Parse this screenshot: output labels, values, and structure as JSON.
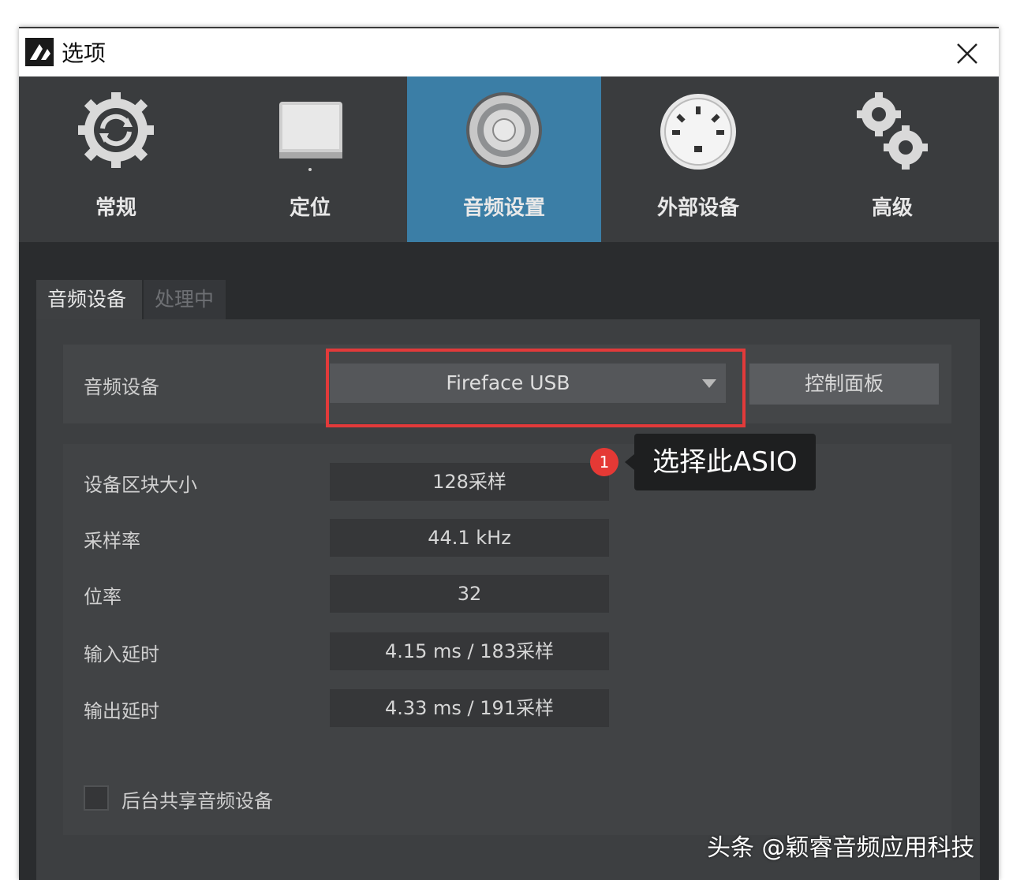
{
  "window": {
    "title": "选项",
    "close_icon": "close-icon"
  },
  "toolbar": {
    "items": [
      {
        "label": "常规",
        "icon": "gear-sync-icon",
        "active": false
      },
      {
        "label": "定位",
        "icon": "drive-icon",
        "active": false
      },
      {
        "label": "音频设置",
        "icon": "speaker-icon",
        "active": true
      },
      {
        "label": "外部设备",
        "icon": "midi-port-icon",
        "active": false
      },
      {
        "label": "高级",
        "icon": "gears-icon",
        "active": false
      }
    ]
  },
  "subtabs": {
    "active": "音频设备",
    "inactive": "处理中"
  },
  "audio_device": {
    "label": "音频设备",
    "value": "Fireface USB",
    "control_button": "控制面板"
  },
  "settings": [
    {
      "label": "设备区块大小",
      "value": "128采样"
    },
    {
      "label": "采样率",
      "value": "44.1 kHz"
    },
    {
      "label": "位率",
      "value": "32"
    },
    {
      "label": "输入延时",
      "value": "4.15 ms / 183采样"
    },
    {
      "label": "输出延时",
      "value": "4.33 ms / 191采样"
    }
  ],
  "checkbox": {
    "label": "后台共享音频设备",
    "checked": false
  },
  "annotation": {
    "badge": "1",
    "text": "选择此ASIO"
  },
  "watermark": "头条 @颖睿音频应用科技",
  "colors": {
    "accent": "#3b7ea6",
    "highlight": "#e23a3a",
    "badge": "#e53935"
  }
}
